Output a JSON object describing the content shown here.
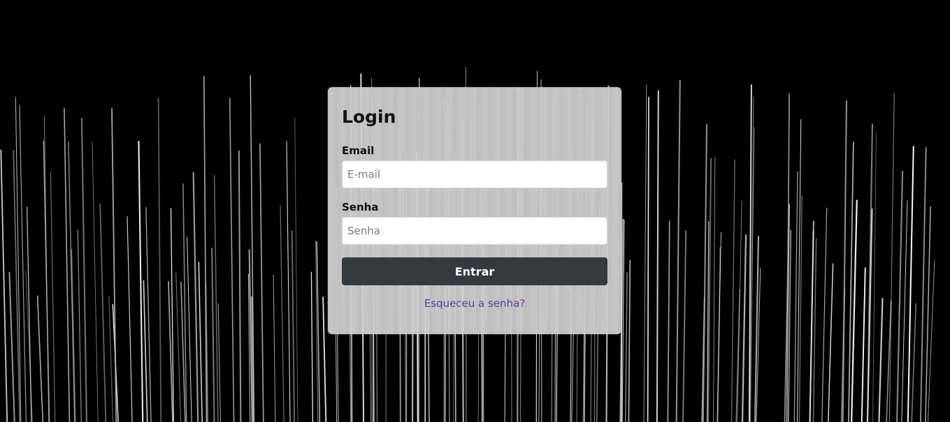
{
  "login": {
    "title": "Login",
    "email_label": "Email",
    "email_placeholder": "E-mail",
    "email_value": "",
    "password_label": "Senha",
    "password_placeholder": "Senha",
    "password_value": "",
    "submit_label": "Entrar",
    "forgot_label": "Esqueceu a senha?"
  },
  "colors": {
    "background": "#000000",
    "card": "#d2d2d2",
    "button": "#353a40",
    "link": "#5f3ea1"
  }
}
